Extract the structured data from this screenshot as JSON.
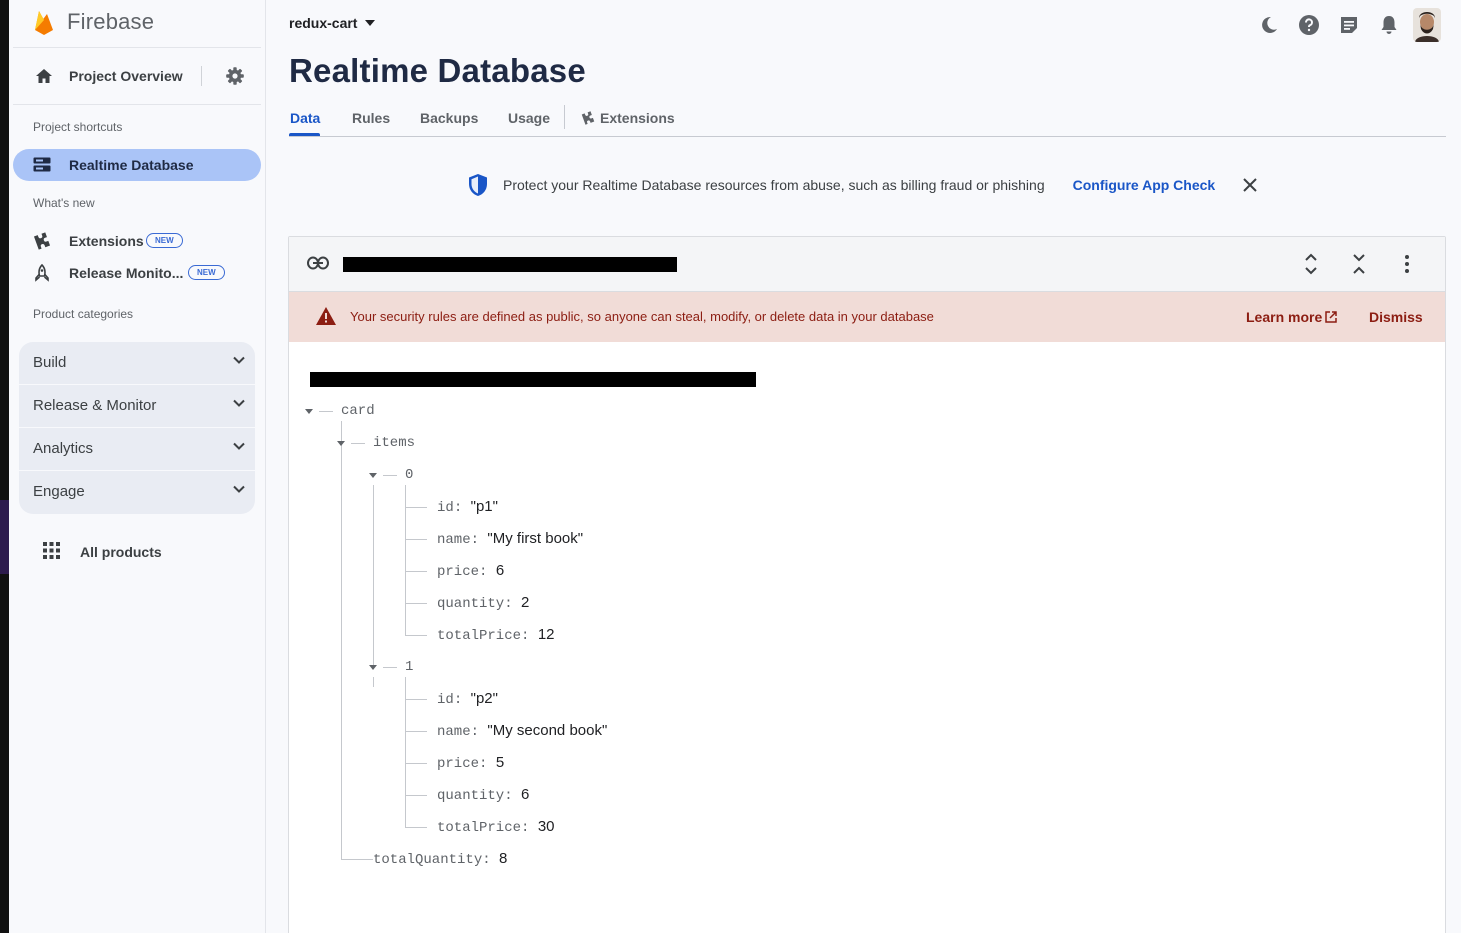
{
  "app": {
    "name": "Firebase"
  },
  "sidebar": {
    "project_overview": "Project Overview",
    "project_shortcuts_label": "Project shortcuts",
    "active_item": "Realtime Database",
    "whats_new_label": "What's new",
    "whats_new": [
      {
        "label": "Extensions",
        "badge": "NEW"
      },
      {
        "label": "Release Monito...",
        "badge": "NEW"
      }
    ],
    "product_categories_label": "Product categories",
    "categories": [
      "Build",
      "Release & Monitor",
      "Analytics",
      "Engage"
    ],
    "all_products": "All products"
  },
  "header": {
    "project": "redux-cart",
    "title": "Realtime Database",
    "icons": [
      "moon-icon",
      "help-icon",
      "release-notes-icon",
      "bell-icon",
      "avatar"
    ]
  },
  "tabs": [
    {
      "label": "Data",
      "active": true
    },
    {
      "label": "Rules"
    },
    {
      "label": "Backups"
    },
    {
      "label": "Usage"
    },
    {
      "label": "Extensions"
    }
  ],
  "appcheck": {
    "message": "Protect your Realtime Database resources from abuse, such as billing fraud or phishing",
    "action": "Configure App Check"
  },
  "warning": {
    "message": "Your security rules are defined as public, so anyone can steal, modify, or delete data in your database",
    "learn_more": "Learn more",
    "dismiss": "Dismiss"
  },
  "tree": {
    "card": "card",
    "items": "items",
    "item0": {
      "key": "0",
      "fields": [
        {
          "k": "id",
          "v": "\"p1\""
        },
        {
          "k": "name",
          "v": "\"My first book\""
        },
        {
          "k": "price",
          "v": "6"
        },
        {
          "k": "quantity",
          "v": "2"
        },
        {
          "k": "totalPrice",
          "v": "12"
        }
      ]
    },
    "item1": {
      "key": "1",
      "fields": [
        {
          "k": "id",
          "v": "\"p2\""
        },
        {
          "k": "name",
          "v": "\"My second book\""
        },
        {
          "k": "price",
          "v": "5"
        },
        {
          "k": "quantity",
          "v": "6"
        },
        {
          "k": "totalPrice",
          "v": "30"
        }
      ]
    },
    "total_quantity": {
      "k": "totalQuantity",
      "v": "8"
    }
  },
  "colors": {
    "accent": "#1a56c7",
    "active_nav": "#aac4f7",
    "warning_bg": "#f1dcd7",
    "warning_text": "#8c1d12"
  }
}
